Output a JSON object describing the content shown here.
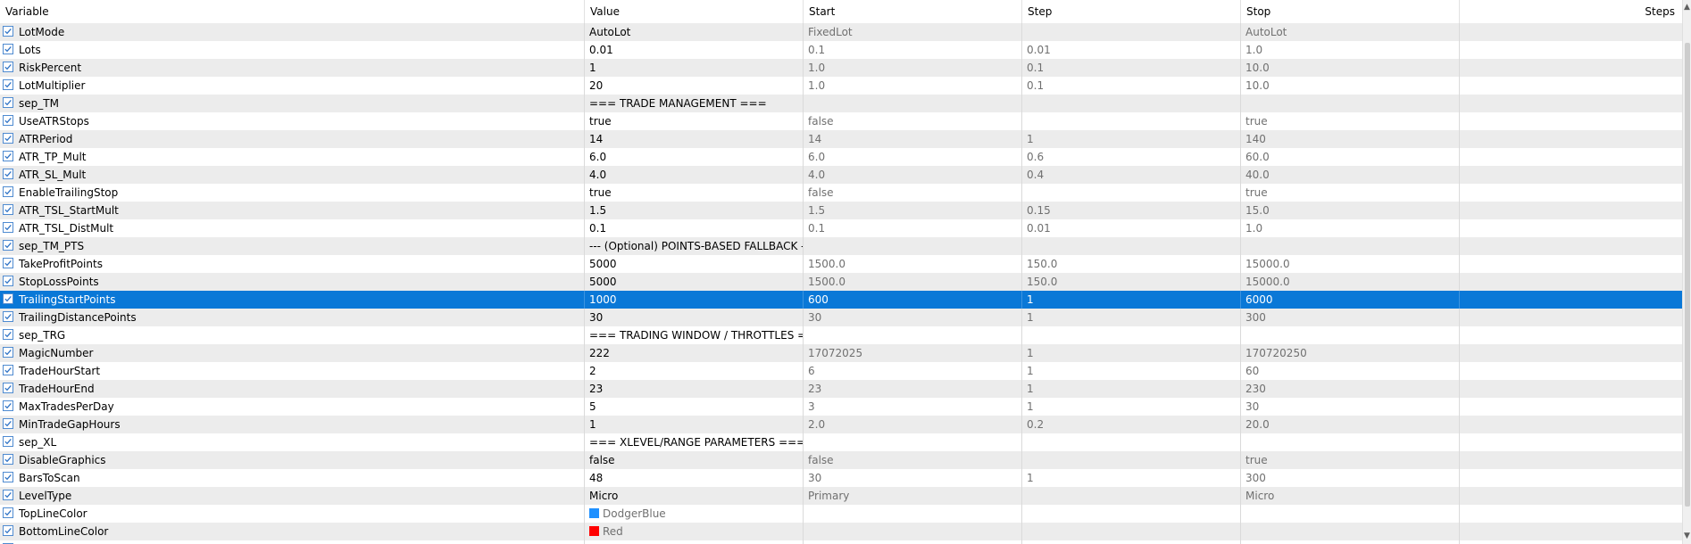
{
  "header": {
    "variable": "Variable",
    "value": "Value",
    "start": "Start",
    "step": "Step",
    "stop": "Stop",
    "steps": "Steps"
  },
  "colors": {
    "selected_row": "#0a78d7",
    "dodgerblue": "#1e90ff",
    "red": "#ff0000"
  },
  "rows": [
    {
      "name": "LotMode",
      "value": "AutoLot",
      "start": "FixedLot",
      "step": "",
      "stop": "AutoLot",
      "checked": true
    },
    {
      "name": "Lots",
      "value": "0.01",
      "start": "0.1",
      "step": "0.01",
      "stop": "1.0",
      "checked": true
    },
    {
      "name": "RiskPercent",
      "value": "1",
      "start": "1.0",
      "step": "0.1",
      "stop": "10.0",
      "checked": true
    },
    {
      "name": "LotMultiplier",
      "value": "20",
      "start": "1.0",
      "step": "0.1",
      "stop": "10.0",
      "checked": true
    },
    {
      "name": "sep_TM",
      "value": "=== TRADE MANAGEMENT ===",
      "start": "",
      "step": "",
      "stop": "",
      "checked": true
    },
    {
      "name": "UseATRStops",
      "value": "true",
      "start": "false",
      "step": "",
      "stop": "true",
      "checked": true
    },
    {
      "name": "ATRPeriod",
      "value": "14",
      "start": "14",
      "step": "1",
      "stop": "140",
      "checked": true
    },
    {
      "name": "ATR_TP_Mult",
      "value": "6.0",
      "start": "6.0",
      "step": "0.6",
      "stop": "60.0",
      "checked": true
    },
    {
      "name": "ATR_SL_Mult",
      "value": "4.0",
      "start": "4.0",
      "step": "0.4",
      "stop": "40.0",
      "checked": true
    },
    {
      "name": "EnableTrailingStop",
      "value": "true",
      "start": "false",
      "step": "",
      "stop": "true",
      "checked": true
    },
    {
      "name": "ATR_TSL_StartMult",
      "value": "1.5",
      "start": "1.5",
      "step": "0.15",
      "stop": "15.0",
      "checked": true
    },
    {
      "name": "ATR_TSL_DistMult",
      "value": "0.1",
      "start": "0.1",
      "step": "0.01",
      "stop": "1.0",
      "checked": true
    },
    {
      "name": "sep_TM_PTS",
      "value": "--- (Optional) POINTS-BASED FALLBACK ---",
      "start": "",
      "step": "",
      "stop": "",
      "checked": true
    },
    {
      "name": "TakeProfitPoints",
      "value": "5000",
      "start": "1500.0",
      "step": "150.0",
      "stop": "15000.0",
      "checked": true
    },
    {
      "name": "StopLossPoints",
      "value": "5000",
      "start": "1500.0",
      "step": "150.0",
      "stop": "15000.0",
      "checked": true
    },
    {
      "name": "TrailingStartPoints",
      "value": "1000",
      "start": "600",
      "step": "1",
      "stop": "6000",
      "checked": true,
      "selected": true
    },
    {
      "name": "TrailingDistancePoints",
      "value": "30",
      "start": "30",
      "step": "1",
      "stop": "300",
      "checked": true
    },
    {
      "name": "sep_TRG",
      "value": "=== TRADING WINDOW / THROTTLES ===",
      "start": "",
      "step": "",
      "stop": "",
      "checked": true
    },
    {
      "name": "MagicNumber",
      "value": "222",
      "start": "17072025",
      "step": "1",
      "stop": "170720250",
      "checked": true
    },
    {
      "name": "TradeHourStart",
      "value": "2",
      "start": "6",
      "step": "1",
      "stop": "60",
      "checked": true
    },
    {
      "name": "TradeHourEnd",
      "value": "23",
      "start": "23",
      "step": "1",
      "stop": "230",
      "checked": true
    },
    {
      "name": "MaxTradesPerDay",
      "value": "5",
      "start": "3",
      "step": "1",
      "stop": "30",
      "checked": true
    },
    {
      "name": "MinTradeGapHours",
      "value": "1",
      "start": "2.0",
      "step": "0.2",
      "stop": "20.0",
      "checked": true
    },
    {
      "name": "sep_XL",
      "value": "=== XLEVEL/RANGE PARAMETERS ===",
      "start": "",
      "step": "",
      "stop": "",
      "checked": true
    },
    {
      "name": "DisableGraphics",
      "value": "false",
      "start": "false",
      "step": "",
      "stop": "true",
      "checked": true
    },
    {
      "name": "BarsToScan",
      "value": "48",
      "start": "30",
      "step": "1",
      "stop": "300",
      "checked": true
    },
    {
      "name": "LevelType",
      "value": "Micro",
      "start": "Primary",
      "step": "",
      "stop": "Micro",
      "checked": true
    },
    {
      "name": "TopLineColor",
      "value": "DodgerBlue",
      "start": "",
      "step": "",
      "stop": "",
      "checked": true,
      "swatch": "#1e90ff"
    },
    {
      "name": "BottomLineColor",
      "value": "Red",
      "start": "",
      "step": "",
      "stop": "",
      "checked": true,
      "swatch": "#ff0000"
    },
    {
      "name": "",
      "value": "",
      "start": "",
      "step": "",
      "stop": "",
      "checked": true
    }
  ]
}
